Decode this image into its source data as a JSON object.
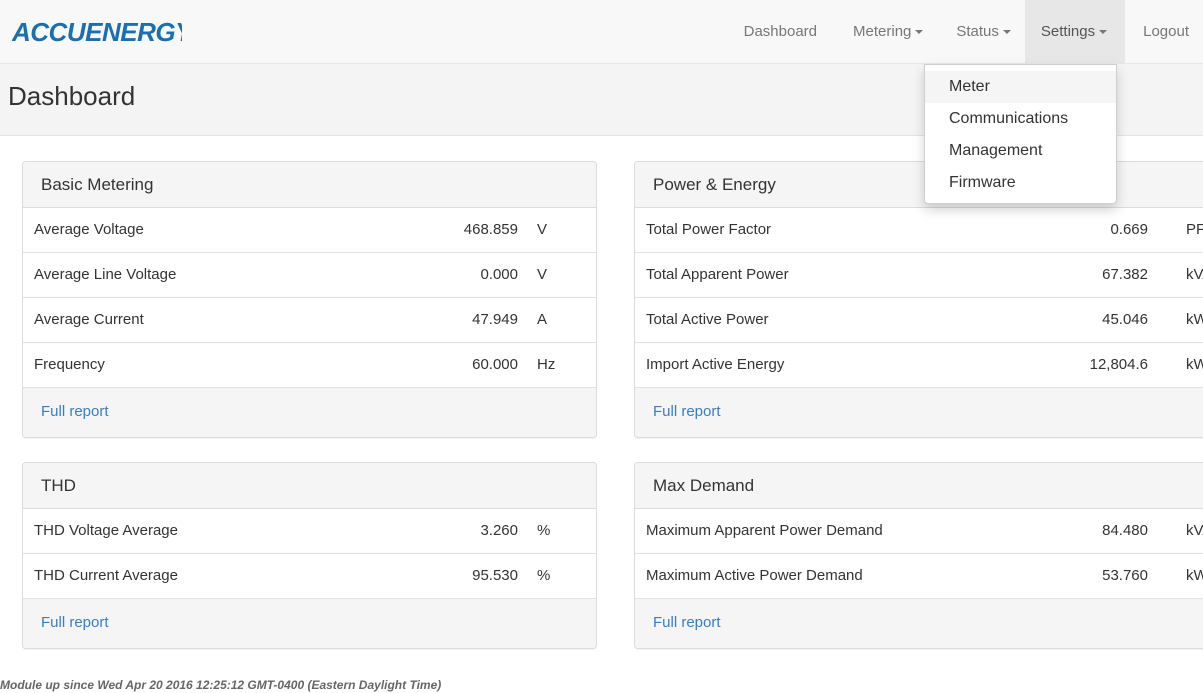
{
  "brand": {
    "logo_text": "ACCUENERGY",
    "logo_color": "#1a6fb0"
  },
  "nav": {
    "dashboard": "Dashboard",
    "metering": "Metering",
    "status": "Status",
    "settings": "Settings",
    "logout": "Logout"
  },
  "settings_menu": {
    "items": [
      "Meter",
      "Communications",
      "Management",
      "Firmware"
    ]
  },
  "page": {
    "title": "Dashboard"
  },
  "panels": {
    "basic_metering": {
      "title": "Basic Metering",
      "rows": [
        {
          "label": "Average Voltage",
          "value": "468.859",
          "unit": "V"
        },
        {
          "label": "Average Line Voltage",
          "value": "0.000",
          "unit": "V"
        },
        {
          "label": "Average Current",
          "value": "47.949",
          "unit": "A"
        },
        {
          "label": "Frequency",
          "value": "60.000",
          "unit": "Hz"
        }
      ],
      "footer": "Full report"
    },
    "power_energy": {
      "title": "Power & Energy",
      "rows": [
        {
          "label": "Total Power Factor",
          "value": "0.669",
          "unit": "PF"
        },
        {
          "label": "Total Apparent Power",
          "value": "67.382",
          "unit": "kVA"
        },
        {
          "label": "Total Active Power",
          "value": "45.046",
          "unit": "kW"
        },
        {
          "label": "Import Active Energy",
          "value": "12,804.6",
          "unit": "kWh"
        }
      ],
      "footer": "Full report"
    },
    "thd": {
      "title": "THD",
      "rows": [
        {
          "label": "THD Voltage Average",
          "value": "3.260",
          "unit": "%"
        },
        {
          "label": "THD Current Average",
          "value": "95.530",
          "unit": "%"
        }
      ],
      "footer": "Full report"
    },
    "max_demand": {
      "title": "Max Demand",
      "rows": [
        {
          "label": "Maximum Apparent Power Demand",
          "value": "84.480",
          "unit": "kVA"
        },
        {
          "label": "Maximum Active Power Demand",
          "value": "53.760",
          "unit": "kW"
        }
      ],
      "footer": "Full report"
    }
  },
  "footer": {
    "uptime": "Module up since Wed Apr 20 2016 12:25:12 GMT-0400 (Eastern Daylight Time)"
  }
}
